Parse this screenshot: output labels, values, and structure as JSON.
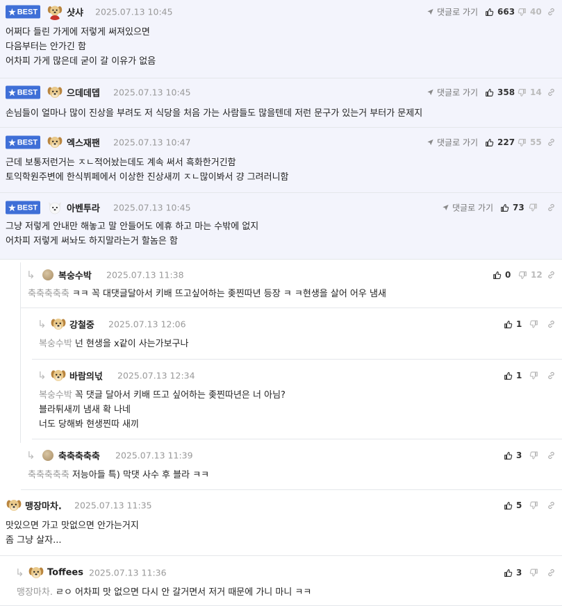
{
  "labels": {
    "best": "BEST",
    "goto_reply": "댓글로 가기"
  },
  "icons": {
    "star": "star-icon",
    "goto": "send-arrow-icon",
    "like": "thumbs-up-icon",
    "dislike": "thumbs-down-icon",
    "share": "link-icon",
    "reply": "reply-arrow-icon",
    "avatar_dog": "puppy-avatar",
    "avatar_plain": "default-avatar"
  },
  "colors": {
    "best_badge": "#3f6fd7",
    "best_bg": "#f3f4fc"
  },
  "best_comments": [
    {
      "nick": "샷샤",
      "date": "2025.07.13 10:45",
      "likes": "663",
      "dislikes": "40",
      "lines": [
        "어쩌다 들린 가게에 저렇게 써져있으면",
        "다음부터는 안가긴 함",
        "어차피 가게 많은데 굳이 갈 이유가 없음"
      ]
    },
    {
      "nick": "으데데뎁",
      "date": "2025.07.13 10:45",
      "likes": "358",
      "dislikes": "14",
      "lines": [
        "손님들이 얼마나 많이 진상을 부려도 저 식당을 처음 가는 사람들도 많을텐데 저런 문구가 있는거 부터가 문제지"
      ]
    },
    {
      "nick": "엑스재팬",
      "date": "2025.07.13 10:47",
      "likes": "227",
      "dislikes": "55",
      "lines": [
        "근데 보통저런거는 ㅈㄴ적어놨는데도 계속 써서 흑화한거긴함",
        "토익학원주변에 한식뷔페에서 이상한 진상새끼 ㅈㄴ많이봐서 걍 그려러니함"
      ]
    },
    {
      "nick": "아벤투라",
      "date": "2025.07.13 10:45",
      "likes": "73",
      "dislikes": "",
      "lines": [
        "그냥 저렇게 안내만 해놓고 말 안들어도 에휴 하고 마는 수밖에 없지",
        "어차피 저렇게 써놔도 하지말라는거 할놈은 함"
      ]
    }
  ],
  "replies": [
    {
      "nick": "복숭수박",
      "date": "2025.07.13 11:38",
      "likes": "0",
      "dislikes": "12",
      "mention": "축축축축축",
      "lines": [
        "ㅋㅋ 꼭 대댓글달아서 키배 뜨고싶어하는 좆찐따년 등장 ㅋ ㅋ현생을 살어 어우 냄새"
      ]
    },
    {
      "nick": "강철중",
      "date": "2025.07.13 12:06",
      "likes": "1",
      "dislikes": "",
      "mention": "복숭수박",
      "lines": [
        "넌 현생을 x같이 사는가보구나"
      ]
    },
    {
      "nick": "바람의넋",
      "date": "2025.07.13 12:34",
      "likes": "1",
      "dislikes": "",
      "mention": "복숭수박",
      "lines": [
        "꼭 댓글 달아서 키배 뜨고 싶어하는 좆찐따년은 너 아님?",
        "블라튀새끼 냄새 확 나네",
        "너도 당해봐 현생찐따 새끼"
      ]
    },
    {
      "nick": "축축축축축",
      "date": "2025.07.13 11:39",
      "likes": "3",
      "dislikes": "",
      "mention": "축축축축축",
      "lines": [
        "저능아들 특) 막댓 사수 후 블라 ㅋㅋ"
      ]
    },
    {
      "nick": "맹장마차.",
      "date": "2025.07.13 11:35",
      "likes": "5",
      "dislikes": "",
      "mention": "",
      "lines": [
        "맛있으면 가고 맛없으면 안가는거지",
        "좀 그냥 살자..."
      ]
    },
    {
      "nick": "Toffees",
      "date": "2025.07.13 11:36",
      "likes": "3",
      "dislikes": "",
      "mention": "맹장마차.",
      "lines": [
        "ㄹㅇ 어차피 맛 없으면 다시 안 갈거면서 저거 때문에 가니 마니 ㅋㅋ"
      ]
    }
  ]
}
